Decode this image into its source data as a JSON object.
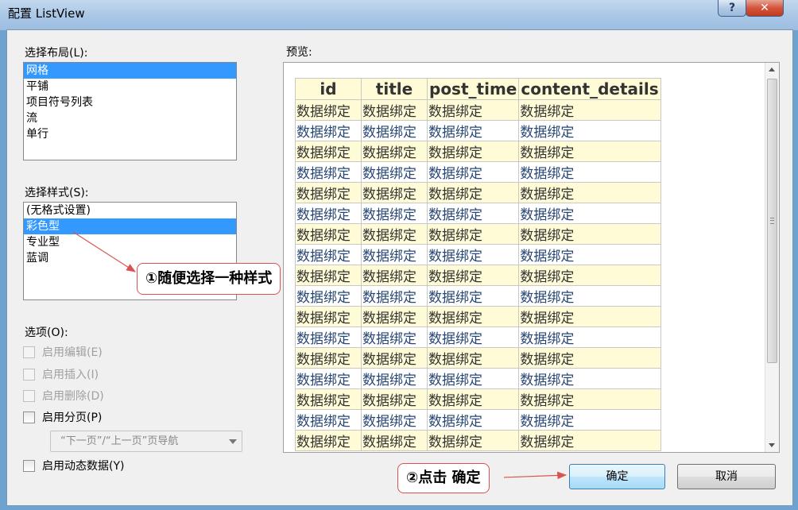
{
  "window": {
    "title": "配置 ListView",
    "help": "?",
    "close": "✕"
  },
  "layout": {
    "label": "选择布局(L):",
    "items": [
      "网格",
      "平铺",
      "项目符号列表",
      "流",
      "单行"
    ],
    "selected": "网格"
  },
  "style": {
    "label": "选择样式(S):",
    "items": [
      "(无格式设置)",
      "彩色型",
      "专业型",
      "蓝调"
    ],
    "selected": "彩色型"
  },
  "options": {
    "label": "选项(O):",
    "enable_edit": "启用编辑(E)",
    "enable_insert": "启用插入(I)",
    "enable_delete": "启用删除(D)",
    "enable_paging": "启用分页(P)",
    "paging_mode": "“下一页”/“上一页”页导航",
    "enable_dynamic": "启用动态数据(Y)"
  },
  "preview": {
    "label": "预览:",
    "columns": [
      "id",
      "title",
      "post_time",
      "content_details"
    ],
    "cell_text": "数据绑定",
    "row_count": 17
  },
  "buttons": {
    "ok": "确定",
    "cancel": "取消"
  },
  "annotations": {
    "step1": "①随便选择一种样式",
    "step2": "②点击 确定"
  },
  "colors": {
    "selection": "#3399ff",
    "row_odd": "#fffbd6",
    "row_even_text": "#284775",
    "callout_border": "#d9534f"
  }
}
